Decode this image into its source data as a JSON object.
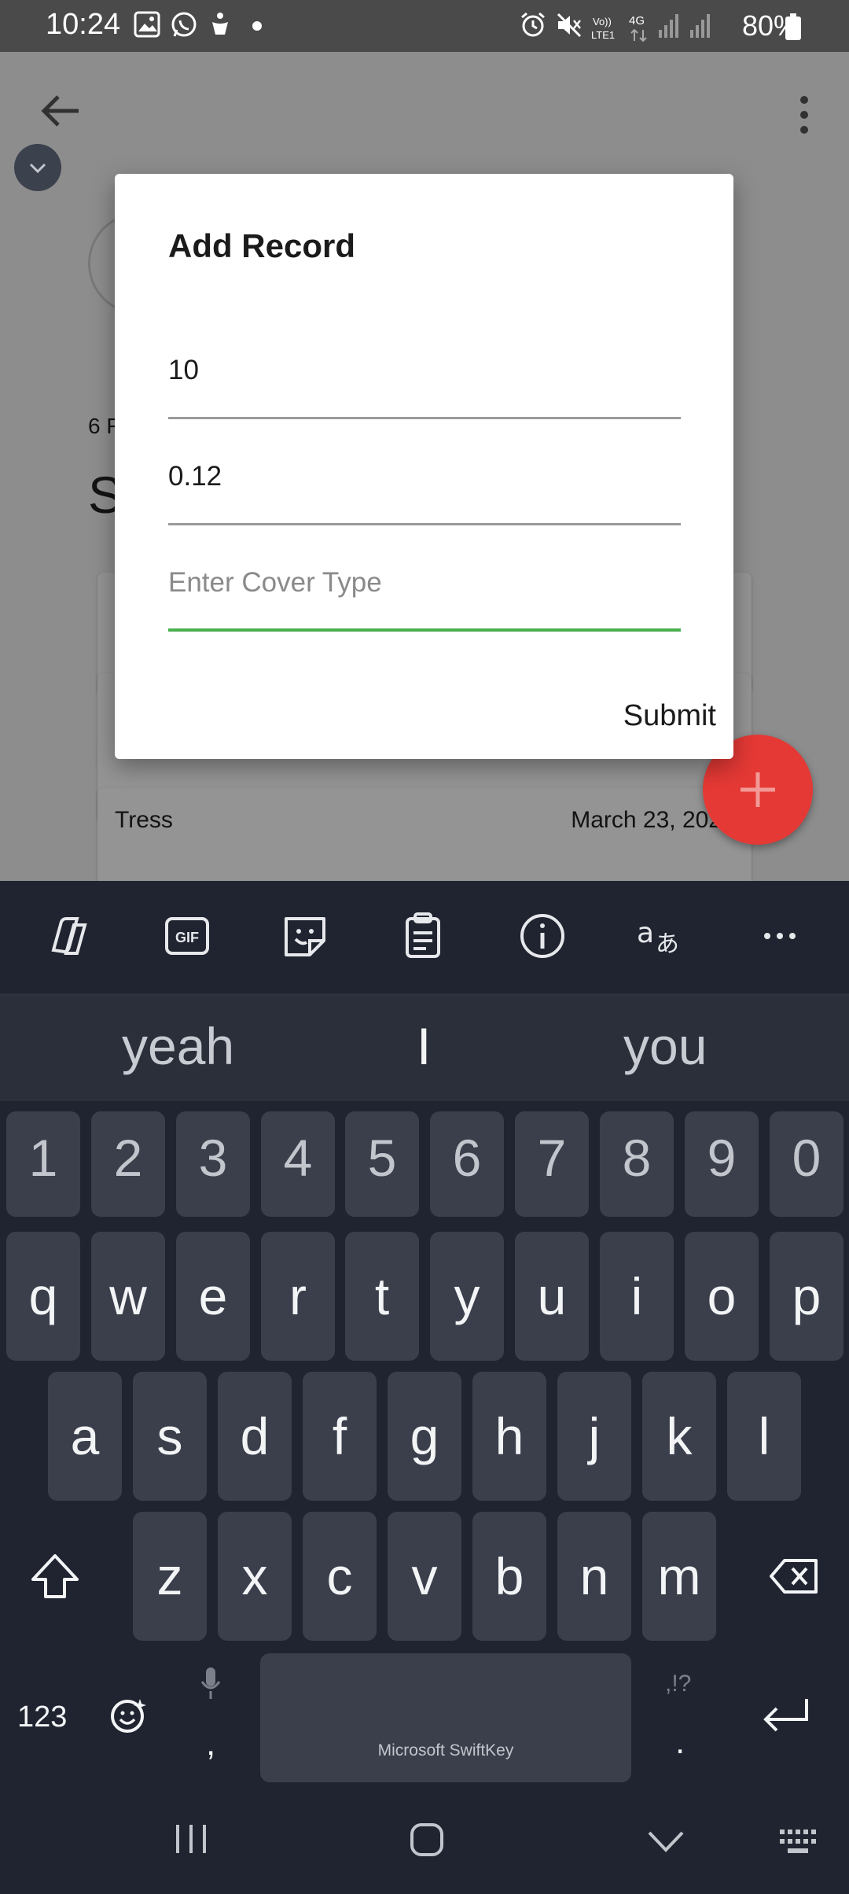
{
  "status_bar": {
    "time": "10:24",
    "battery": "80%",
    "icons": [
      "gallery-icon",
      "whatsapp-icon",
      "accessibility-icon",
      "dot-icon",
      "alarm-icon",
      "mute-icon",
      "volte-icon",
      "4g-icon",
      "signal-icon",
      "signal-icon",
      "battery-icon"
    ]
  },
  "app": {
    "partial_label": "6 F",
    "partial_title": "S",
    "row": {
      "name": "Tress",
      "date": "March 23, 202"
    }
  },
  "dialog": {
    "title": "Add Record",
    "field1_value": "10",
    "field2_value": "0.12",
    "field3_placeholder": "Enter Cover Type",
    "submit_label": "Submit"
  },
  "keyboard": {
    "toolbar": [
      "copilot-icon",
      "gif-icon",
      "sticker-icon",
      "clipboard-icon",
      "info-icon",
      "translate-icon",
      "more-icon"
    ],
    "suggestions": [
      "yeah",
      "I",
      "you"
    ],
    "number_row": [
      "1",
      "2",
      "3",
      "4",
      "5",
      "6",
      "7",
      "8",
      "9",
      "0"
    ],
    "row1": [
      "q",
      "w",
      "e",
      "r",
      "t",
      "y",
      "u",
      "i",
      "o",
      "p"
    ],
    "row2": [
      "a",
      "s",
      "d",
      "f",
      "g",
      "h",
      "j",
      "k",
      "l"
    ],
    "row3": [
      "z",
      "x",
      "c",
      "v",
      "b",
      "n",
      "m"
    ],
    "numbers_key": "123",
    "comma_key": ",",
    "period_key": ".",
    "punct_hint": ",!?",
    "space_label": "Microsoft SwiftKey"
  },
  "colors": {
    "accent_green": "#4caf50",
    "fab_red": "#e53935",
    "keyboard_bg": "#1f2430",
    "key_bg": "#3a3f4b"
  }
}
